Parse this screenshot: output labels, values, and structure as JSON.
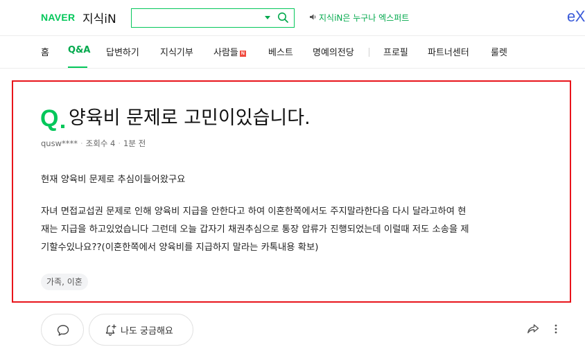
{
  "header": {
    "naver_logo": "NAVER",
    "service_logo": "지식iN",
    "search": {
      "value": "",
      "placeholder": ""
    },
    "expert_link": "지식iN은 누구나 엑스퍼트",
    "ex_logo": "eX"
  },
  "nav": {
    "items": [
      {
        "label": "홈"
      },
      {
        "label": "Q&A",
        "active": true
      },
      {
        "label": "답변하기"
      },
      {
        "label": "지식기부"
      },
      {
        "label": "사람들",
        "badge": "N"
      },
      {
        "label": "베스트"
      },
      {
        "label": "명예의전당"
      },
      {
        "label": "프로필"
      },
      {
        "label": "파트너센터"
      },
      {
        "label": "룰렛"
      }
    ]
  },
  "question": {
    "q_mark": "Q",
    "title": "양육비 문제로 고민이있습니다.",
    "author": "qusw****",
    "views": "조회수 4",
    "time": "1분 전",
    "body_p1": "현재 양육비 문제로 추심이들어왔구요",
    "body_p2_lines": [
      "자녀 면접교섭권 문제로 인해 양육비 지급을 안한다고 하여 이혼한쪽에서도 주지말라한다음 다시 달라고하여 현",
      "재는 지급을 하고있었습니다 그런데 오늘 갑자기 채권추심으로 통장 압류가 진행되었는데 이럴때 저도 소송을 제",
      "기할수있나요??(이혼한쪽에서 양육비를 지급하지 말라는 카톡내용 확보)"
    ],
    "tag": "가족, 이혼"
  },
  "actions": {
    "curious_label": "나도 궁금해요"
  },
  "colors": {
    "brand_green": "#03c75a",
    "highlight_border": "#e8141b",
    "ex_blue": "#3a5bd9"
  }
}
